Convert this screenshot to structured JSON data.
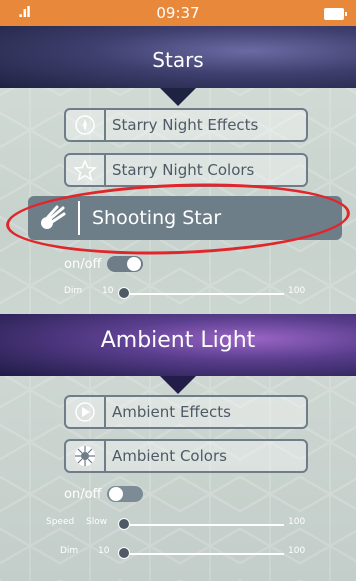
{
  "status_bar": {
    "time": "09:37",
    "signal_icon": "signal-icon",
    "battery_icon": "battery-icon"
  },
  "stars_section": {
    "title": "Stars",
    "buttons": [
      {
        "label": "Starry Night Effects",
        "icon": "compass-star-icon"
      },
      {
        "label": "Starry Night Colors",
        "icon": "star-outline-icon"
      }
    ],
    "selected": {
      "label": "Shooting Star",
      "icon": "shooting-star-icon"
    },
    "toggle": {
      "label": "on/off",
      "state": "on"
    },
    "dim_slider": {
      "name": "Dim",
      "min_label": "10",
      "max_label": "100",
      "value_fraction": 0.0
    }
  },
  "ambient_section": {
    "title": "Ambient Light",
    "buttons": [
      {
        "label": "Ambient Effects",
        "icon": "play-icon"
      },
      {
        "label": "Ambient Colors",
        "icon": "color-wheel-icon"
      }
    ],
    "toggle": {
      "label": "on/off",
      "state": "off"
    },
    "speed_slider": {
      "name": "Speed",
      "min_label": "Slow",
      "max_label": "100",
      "value_fraction": 0.0
    },
    "dim_slider": {
      "name": "Dim",
      "min_label": "10",
      "max_label": "100",
      "value_fraction": 0.0
    }
  },
  "colors": {
    "status_bar": "#e8883a",
    "highlight_ring": "#e1262b",
    "button_border": "#6e7d88"
  }
}
